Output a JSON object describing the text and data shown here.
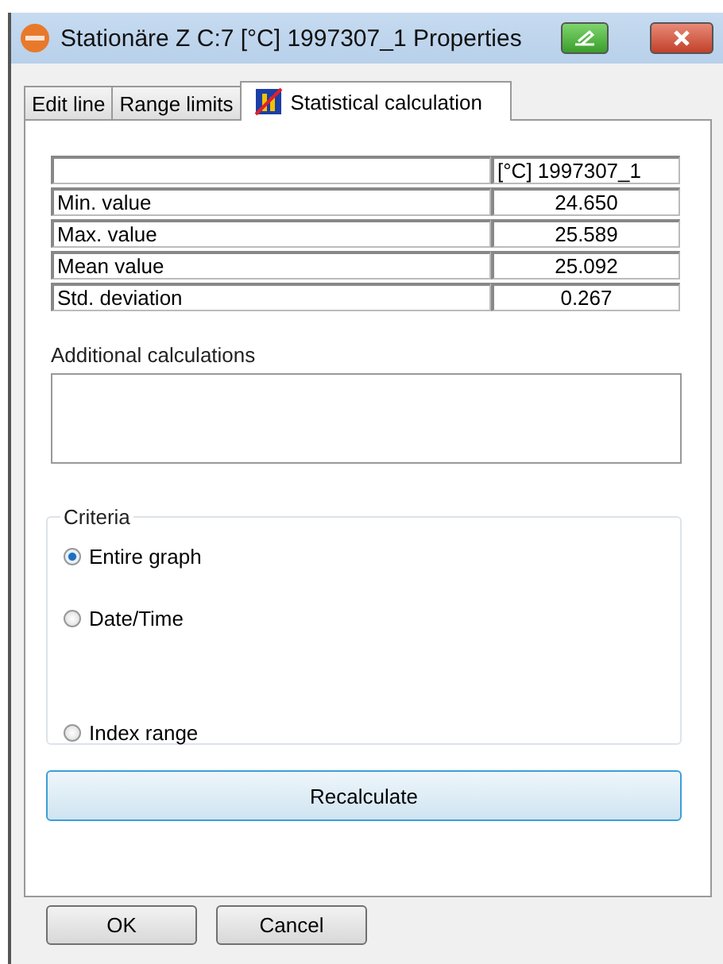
{
  "window": {
    "title": "Stationäre Z C:7 [°C] 1997307_1 Properties"
  },
  "tabs": [
    {
      "label": "Edit line",
      "selected": false,
      "kind": "text"
    },
    {
      "label": "Range limits",
      "selected": false,
      "kind": "text"
    },
    {
      "label": "Statistical calculation",
      "selected": true,
      "kind": "icon"
    }
  ],
  "table": {
    "columns": [
      "",
      "[°C] 1997307_1"
    ],
    "rows": [
      {
        "label": "Min. value",
        "value": "24.650"
      },
      {
        "label": "Max. value",
        "value": "25.589"
      },
      {
        "label": "Mean value",
        "value": "25.092"
      },
      {
        "label": "Std. deviation",
        "value": "0.267"
      }
    ]
  },
  "additional": {
    "label": "Additional calculations"
  },
  "criteria": {
    "title": "Criteria",
    "options": [
      {
        "label": "Entire graph",
        "selected": true
      },
      {
        "label": "Date/Time",
        "selected": false
      },
      {
        "label": "Index range",
        "selected": false
      }
    ]
  },
  "recalculate": "Recalculate",
  "buttons": [
    "OK",
    "Cancel"
  ]
}
